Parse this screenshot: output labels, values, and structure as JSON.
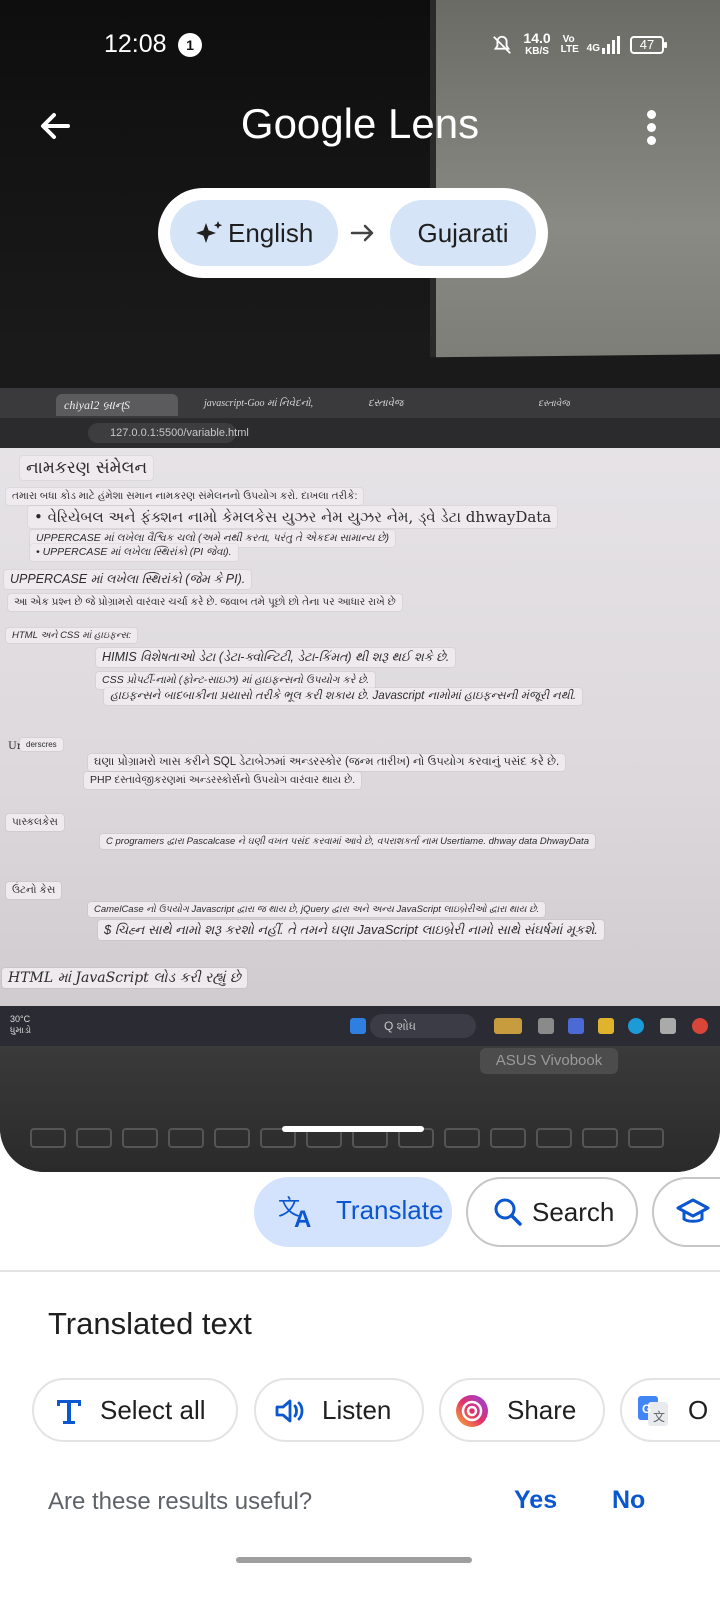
{
  "status_bar": {
    "time": "12:08",
    "notification_count": "1",
    "net_speed": "14.0",
    "net_unit": "KB/S",
    "volte": "Vo LTE",
    "network": "4G",
    "battery": "47"
  },
  "header": {
    "title": "Google Lens"
  },
  "language": {
    "source": "English",
    "target": "Gujarati"
  },
  "photo": {
    "tabs": [
      "chiyal2 બ્રાન્S",
      "javascript-Goo માં નિવેદનો,",
      "દસ્તાવેજ",
      "દસ્તાવેજ"
    ],
    "url": "127.0.0.1:5500/variable.html",
    "overlays": {
      "l1": "નામકરણ સંમેલન",
      "l2": "તમારા બધા કોડ માટે હંમેશા સમાન નામકરણ સંમેલનનો ઉપયોગ કરો. દાખલા તરીકે:",
      "l3": "• વેરિયેબલ અને ફંક્શન નામો કેમલકેસ યુઝર નેમ યુઝર નેમ, ડ્વે ડેટા dhwayData",
      "l4": "UPPERCASE માં લખેલા વૈશ્વિક ચલો (અમે નથી કરતા, પરંતુ તે એકદમ સામાન્ય છે)",
      "l5": "• UPPERCASE માં લખેલા સ્થિરાંકો (PI જેવા).",
      "l6": "UPPERCASE માં લખેલા સ્થિરાંકો (જેમ કે PI).",
      "l7": "આ એક પ્રશ્ન છે જે પ્રોગ્રામરો વારંવાર ચર્ચા કરે છે. જવાબ તમે પૂછો છો તેના પર આધાર રાખે છે",
      "l8": "HTML અને CSS માં હાઇફન્સ:",
      "l9": "HIMIS વિશેષતાઓ ડેટા (ડેટા-ક્વોન્ટિટી, ડેટા-કિંમત) થી શરૂ થઈ શકે છે.",
      "l10": "CSS પ્રોપર્ટી-નામો (ફોન્ટ-સાઇઝ) માં હાઇફન્સનો ઉપયોગ કરે છે.",
      "l11": "હાઇફન્સને બાદબાકીના પ્રયાસો તરીકે ભૂલ કરી શકાય છે. Javascript નામોમાં હાઇફન્સની મંજૂરી નથી.",
      "l12": "Ur",
      "l13": "derscres",
      "l14": "ઘણા પ્રોગ્રામરો ખાસ કરીને SQL ડેટાબેઝમાં અન્ડરસ્કોર (જન્મ તારીખ) નો ઉપયોગ કરવાનું પસંદ કરે છે.",
      "l15": "PHP દસ્તાવેજીકરણમાં અન્ડરસ્કોર્સનો ઉપયોગ વારંવાર થાય છે.",
      "l16": "પાસ્કલકેસ",
      "l17": "C programers દ્વારા Pascalcase ને ઘણી વખત પસંદ કરવામાં આવે છે, વપરાશકર્તા નામ Usertiame. dhway data DhwayData",
      "l18": "ઉંટનો કેસ",
      "l19": "CamelCase નો ઉપયોગ Javascript દ્વારા જ થાય છે, jQuery દ્વારા અને અન્ય JavaScript લાઇબ્રેરીઓ દ્વારા થાય છે.",
      "l20": "$ ચિહ્ન સાથે નામો શરૂ કરશો નહીં. તે તમને ઘણા JavaScript લાઇબ્રેરી નામો સાથે સંઘર્ષમાં મૂકશે.",
      "l21": "HTML માં JavaScript લોડ કરી રહ્યું છે"
    },
    "weather_temp": "30°C",
    "weather_label": "ધુમાડો",
    "taskbar_search": "Q શોધ",
    "laptop_brand": "ASUS Vivobook"
  },
  "chips": {
    "translate": "Translate",
    "search": "Search"
  },
  "sheet": {
    "title": "Translated text",
    "select_all": "Select all",
    "listen": "Listen",
    "share": "Share",
    "open": "O",
    "feedback_question": "Are these results useful?",
    "yes": "Yes",
    "no": "No"
  },
  "colors": {
    "accent": "#0b57d0",
    "chip_active_bg": "#d3e3fd",
    "lang_btn_bg": "#d6e4f8"
  }
}
